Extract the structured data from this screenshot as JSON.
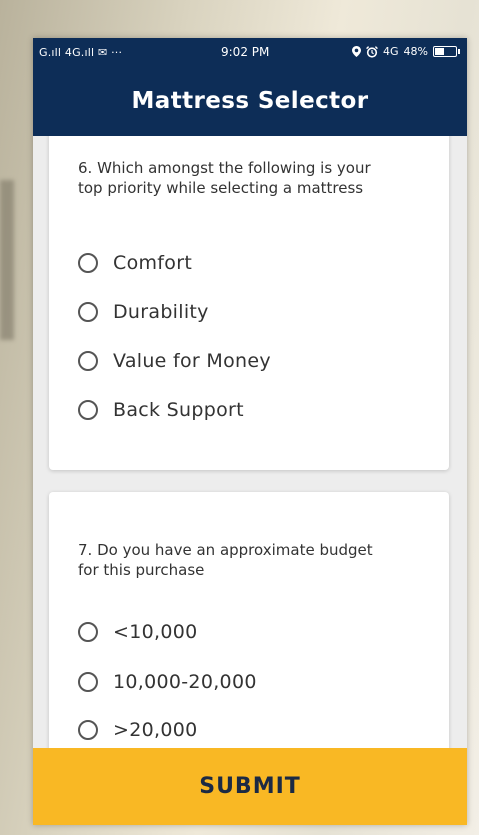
{
  "status_bar": {
    "left": "G.ıll 4G.ıll ✉ ···",
    "time": "9:02 PM",
    "network": "4G",
    "battery": "48%",
    "battery_level": 0.48
  },
  "app_bar": {
    "title": "Mattress Selector"
  },
  "questions": [
    {
      "text": "6. Which amongst the following is your top priority while selecting a mattress",
      "options": [
        "Comfort",
        "Durability",
        "Value for Money",
        "Back Support"
      ]
    },
    {
      "text": "7. Do you have an approximate budget for this purchase",
      "options": [
        "<10,000",
        "10,000-20,000",
        ">20,000"
      ]
    }
  ],
  "submit_label": "SUBMIT"
}
